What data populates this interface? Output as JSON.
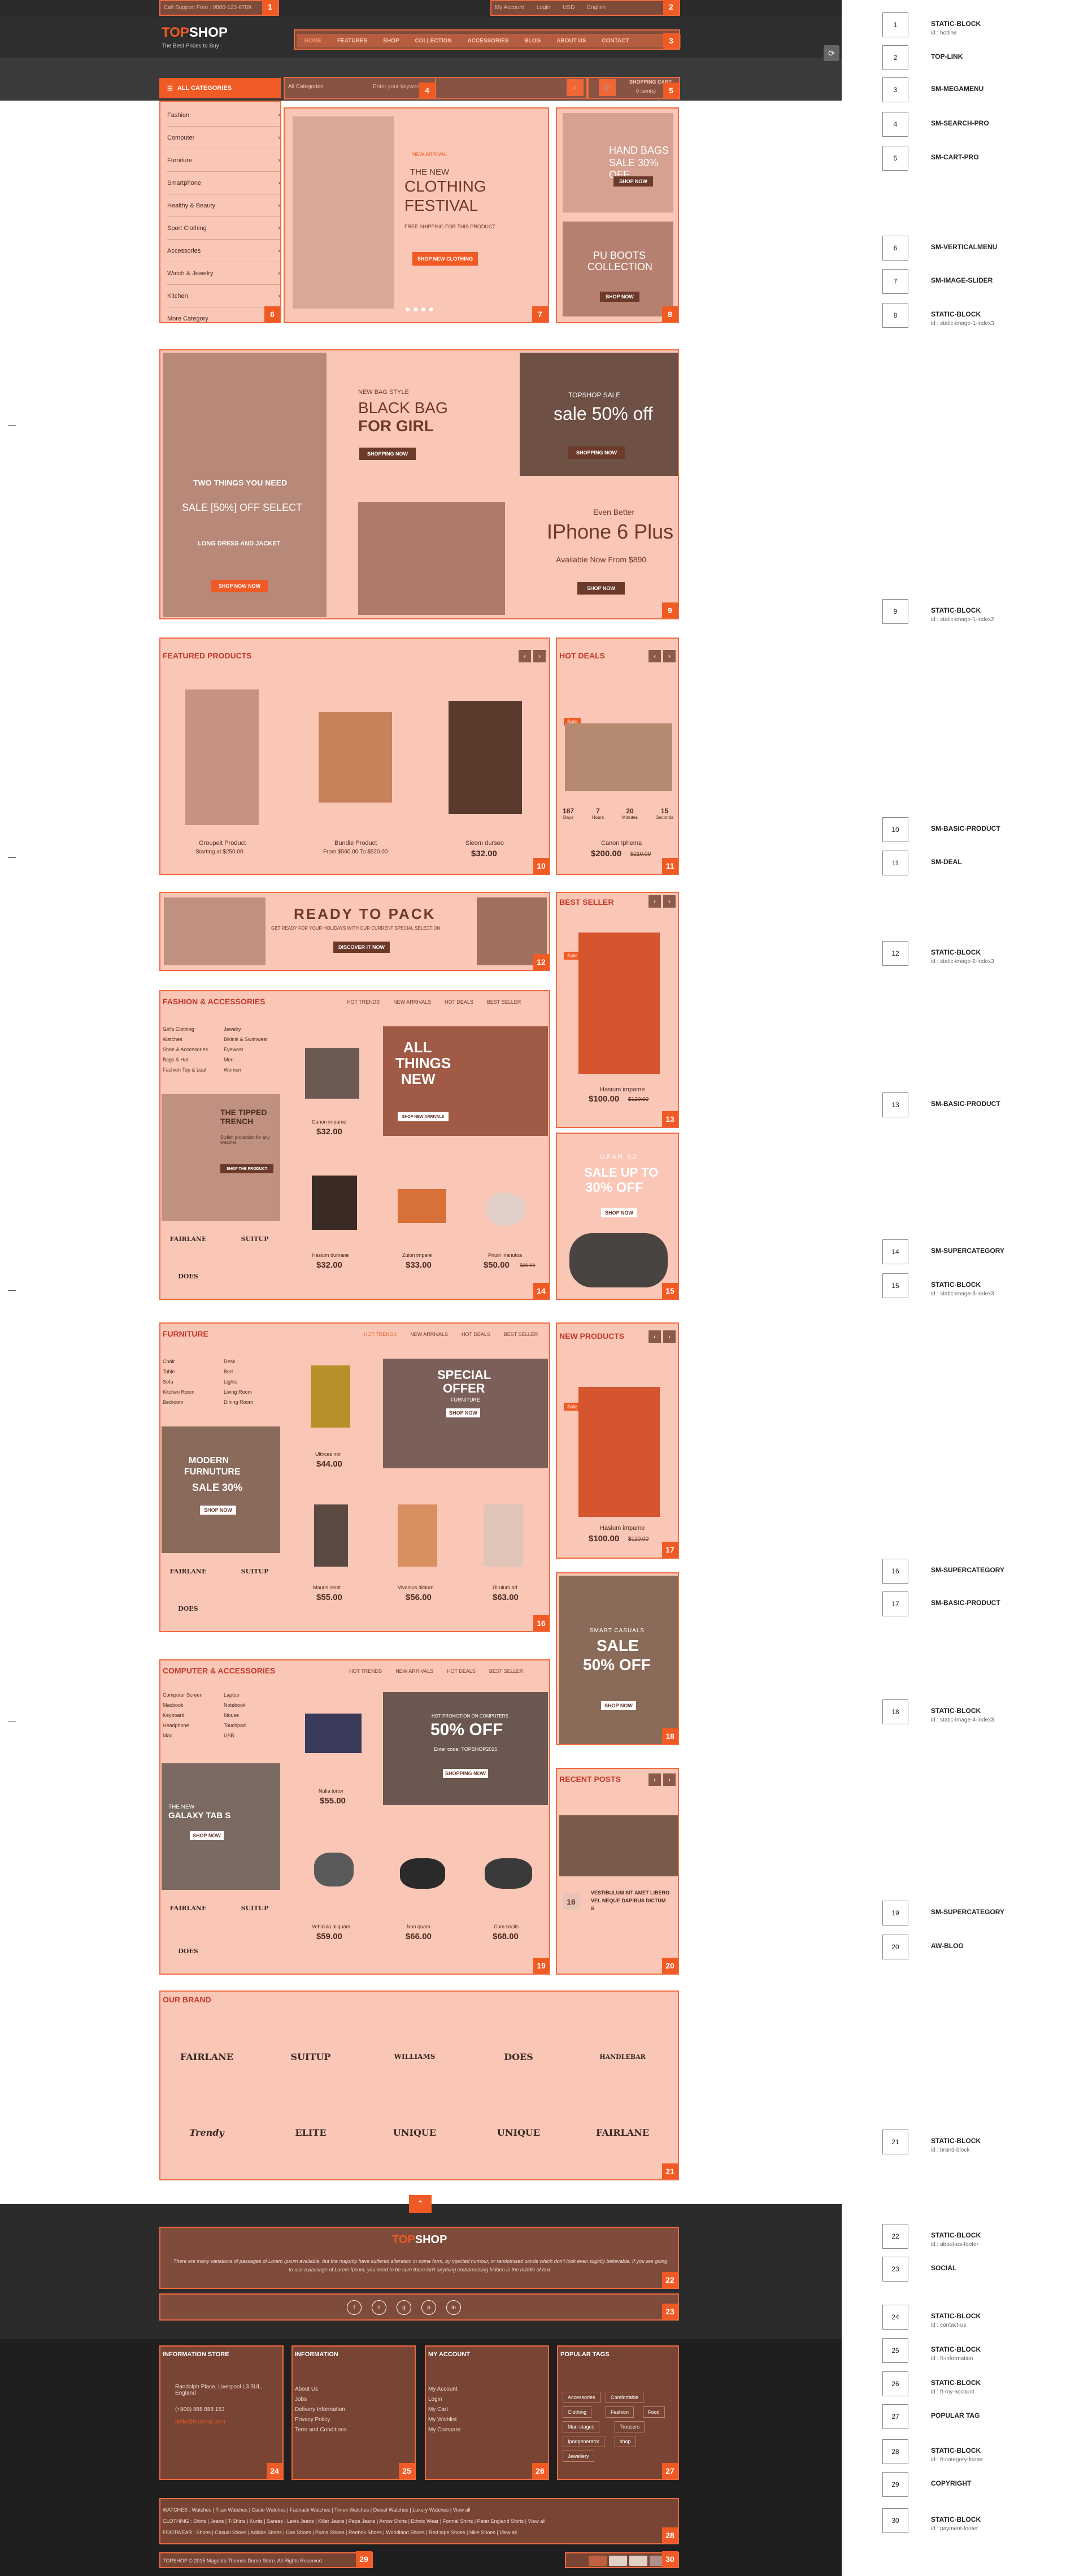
{
  "header": {
    "hotline": "Call Support Free : 0800-123-6789",
    "logo_top": "TOP",
    "logo_shop": "SHOP",
    "tagline": "The Best Prices to Buy",
    "account": "My Account",
    "wishlist": "Login",
    "currency": "USD",
    "language": "English",
    "nav": [
      "HOME",
      "FEATURES",
      "SHOP",
      "COLLECTION",
      "ACCESSORIES",
      "BLOG",
      "ABOUT US",
      "CONTACT"
    ],
    "categories_label": "ALL CATEGORIES",
    "search_select": "All Categories",
    "search_placeholder": "Enter your keyword",
    "cart_label": "SHOPPING CART",
    "cart_count": "0 item(s)"
  },
  "sidebar_menu": [
    "Fashion",
    "Computer",
    "Furniture",
    "Smartphone",
    "Healthy & Beauty",
    "Sport Clothing",
    "Accessories",
    "Watch & Jewelry",
    "Kitchen",
    "More Category"
  ],
  "slider": {
    "kicker": "NEW ARRIVAL",
    "title_1": "THE NEW",
    "title_2": "CLOTHING",
    "title_3": "FESTIVAL",
    "sub": "FREE SHIPPING FOR THIS PRODUCT",
    "button": "SHOP NEW CLOTHING"
  },
  "side_banners": [
    {
      "title": "HAND BAGS",
      "sub": "SALE 30% OFF",
      "button": "SHOP NOW"
    },
    {
      "title": "PU BOOTS",
      "sub": "COLLECTION",
      "button": "SHOP NOW"
    }
  ],
  "banners_2": {
    "left_title": "TWO THINGS YOU NEED",
    "left_sale": "SALE [50%] OFF SELECT",
    "left_sub": "LONG DRESS AND JACKET",
    "left_btn": "SHOP NOW NOW",
    "bag_kicker": "NEW BAG STYLE",
    "bag_title_1": "BLACK BAG",
    "bag_title_2": "FOR GIRL",
    "bag_btn": "SHOPPING NOW",
    "top_kicker": "TOPSHOP SALE",
    "top_sale": "sale 50% off",
    "top_btn": "SHOPPING NOW",
    "phone_kicker": "Even Better",
    "phone_title": "IPhone 6 Plus",
    "phone_sub": "Available Now From $890",
    "phone_btn": "SHOP NOW"
  },
  "featured": {
    "title": "FEATURED PRODUCTS",
    "items": [
      {
        "name": "Groupeit Product",
        "price": "Starting at $250.00"
      },
      {
        "name": "Bundle Product",
        "price": "From $560.00 To $520.00"
      },
      {
        "name": "Sieom durseo",
        "price": "$32.00"
      }
    ]
  },
  "hot_deals": {
    "title": "HOT DEALS",
    "countdown": [
      {
        "v": "187",
        "l": "Days"
      },
      {
        "v": "7",
        "l": "Hours"
      },
      {
        "v": "20",
        "l": "Minutes"
      },
      {
        "v": "15",
        "l": "Seconds"
      }
    ],
    "name": "Canon Iphema",
    "price": "$200.00",
    "old": "$210.00",
    "badge": "Sale"
  },
  "ready": {
    "title": "READY TO PACK",
    "sub": "GET READY FOR YOUR HOLIDAYS WITH OUR CURRENT SPECIAL SELECTION",
    "button": "DISCOVER IT NOW"
  },
  "best_seller": {
    "title": "BEST SELLER",
    "name": "Hasium impame",
    "price": "$100.00",
    "old": "$120.00",
    "badge": "Sale"
  },
  "fashion": {
    "title": "FASHION & ACCESSORIES",
    "tabs": [
      "HOT TRENDS",
      "NEW ARRIVALS",
      "HOT DEALS",
      "BEST SELLER"
    ],
    "links_a": [
      "Girl's Clothing",
      "Watches",
      "Shoe & Accessories",
      "Bags & Hat",
      "Fashion Top & Leaf"
    ],
    "links_b": [
      "Jewelry",
      "Bikinis & Swimwear",
      "Eyewear",
      "Men",
      "Women"
    ],
    "promo_title": "THE TIPPED TRENCH",
    "promo_sub": "Stylish protection for any weather",
    "promo_btn": "SHOP THE PRODUCT",
    "hero_title_1": "ALL",
    "hero_title_2": "THINGS",
    "hero_title_3": "NEW",
    "hero_btn": "SHOP NEW ARRIVALS",
    "items": [
      {
        "name": "Canon impame",
        "price": "$32.00"
      },
      {
        "name": "Hasium dumane",
        "price": "$32.00"
      },
      {
        "name": "Zuion impare",
        "price": "$33.00"
      },
      {
        "name": "Priuin inanutoa",
        "price": "$50.00",
        "old": "$00.00"
      }
    ],
    "brands": [
      "FAIRLANE",
      "SUITUP",
      "DOES"
    ]
  },
  "sale_banner": {
    "kicker": "GEAR S2",
    "title": "SALE UP TO",
    "pct": "30% OFF",
    "button": "SHOP NOW"
  },
  "furniture": {
    "title": "FURNITURE",
    "tabs": [
      "HOT TRENDS",
      "NEW ARRIVALS",
      "HOT DEALS",
      "BEST SELLER"
    ],
    "links_a": [
      "Chair",
      "Table",
      "Sofa",
      "Kitchen Room",
      "Bedroom"
    ],
    "links_b": [
      "Desk",
      "Bed",
      "Lights",
      "Living Room",
      "Dining Room"
    ],
    "promo_title_1": "MODERN",
    "promo_title_2": "FURNUTURE",
    "promo_sale": "SALE 30%",
    "promo_btn": "SHOP NOW",
    "hero_title_1": "SPECIAL",
    "hero_title_2": "OFFER",
    "hero_sub": "FURNITURE",
    "hero_btn": "SHOP NOW",
    "items": [
      {
        "name": "Ultrices mir",
        "price": "$44.00"
      },
      {
        "name": "Mauris sentt",
        "price": "$55.00"
      },
      {
        "name": "Vivamus dictum",
        "price": "$56.00"
      },
      {
        "name": "Ut ulum ad",
        "price": "$63.00"
      }
    ],
    "brands": [
      "FAIRLANE",
      "SUITUP",
      "DOES"
    ]
  },
  "new_products": {
    "title": "NEW PRODUCTS",
    "name": "Hasium impame",
    "price": "$100.00",
    "old": "$120.00",
    "badge": "Sale"
  },
  "smart_casual": {
    "kicker": "SMART CASUALS",
    "title": "SALE",
    "pct": "50% OFF",
    "button": "SHOP NOW"
  },
  "computer": {
    "title": "COMPUTER & ACCESSORIES",
    "tabs": [
      "HOT TRENDS",
      "NEW ARRIVALS",
      "HOT DEALS",
      "BEST SELLER"
    ],
    "links_a": [
      "Computer Screen",
      "Macbook",
      "Keyboard",
      "Headphone",
      "Mac"
    ],
    "links_b": [
      "Laptop",
      "Notebook",
      "Mouse",
      "Touchpad",
      "USB"
    ],
    "promo_title_1": "THE NEW",
    "promo_title_2": "GALAXY TAB S",
    "promo_btn": "SHOP NOW",
    "hero_kicker": "HOT PROMOTION ON COMPUTERS",
    "hero_pct": "50% OFF",
    "hero_sub": "Enter code: TOPSHOP2015",
    "hero_btn": "SHOPPING NOW",
    "items": [
      {
        "name": "Nulla tortor",
        "price": "$55.00"
      },
      {
        "name": "Vehicula aliquam",
        "price": "$59.00"
      },
      {
        "name": "Non quam",
        "price": "$66.00"
      },
      {
        "name": "Cum sociis",
        "price": "$68.00"
      }
    ],
    "brands": [
      "FAIRLANE",
      "SUITUP",
      "DOES"
    ]
  },
  "recent_posts": {
    "title": "RECENT POSTS",
    "date": "16",
    "post": "VESTIBULUM SIT AMET LIBERO VEL NEQUE DAPIBUS DICTUM S"
  },
  "our_brand": {
    "title": "OUR BRAND",
    "row1": [
      "FAIRLANE",
      "SUITUP",
      "WILLIAMS",
      "DOES",
      "HANDLEBAR"
    ],
    "row2": [
      "Trendy",
      "ELITE",
      "UNIQUE",
      "UNIQUE",
      "FAIRLANE"
    ]
  },
  "footer": {
    "logo_top": "TOP",
    "logo_shop": "SHOP",
    "about": "There are many variations of passages of Lorem Ipsum available, but the majority have suffered alteration in some form, by injected humour, or randomised words which don't look even slightly believable. If you are going to use a passage of Lorem Ipsum, you need to be sure there isn't anything embarrassing hidden in the middle of text.",
    "social": [
      "f",
      "t",
      "g",
      "p",
      "in"
    ],
    "col1_title": "INFORMATION STORE",
    "col1": [
      "Randolph Place, Liverpool L3 5UL, England",
      "(+800) 888 888 153",
      "hello@topshop.com"
    ],
    "col2_title": "INFORMATION",
    "col2": [
      "About Us",
      "Jobs",
      "Delivery Information",
      "Privacy Policy",
      "Term and Conditions"
    ],
    "col3_title": "MY ACCOUNT",
    "col3": [
      "My Account",
      "Login",
      "My Cart",
      "My Wishlist",
      "My Compare"
    ],
    "col4_title": "POPULAR TAGS",
    "tags": [
      "Accessories",
      "Comfortable",
      "Clothing",
      "Fashion",
      "Food",
      "Man-stages",
      "Trousers",
      "Ipodgenerator",
      "shop",
      "Jewellery"
    ],
    "watches": "WATCHES : Watches | Titan Watches | Casio Watches | Fastrack Watches | Timex Watches | Diesel Watches | Luxury Watches | View all",
    "clothing": "CLOTHING : Shirts | Jeans | T-Shirts | Kurtis | Sarees | Levis Jeans | Killer Jeans | Pepe Jeans | Arrow Shirts | Ethnic Wear | Formal Shirts | Peter England Shirts | View all",
    "footwear": "FOOTWEAR : Shoes | Casual Shoes | Adidas Shoes | Gas Shoes | Puma Shoes | Reebok Shoes | Woodland Shoes | Red tape Shoes | Nike Shoes | View all",
    "copyright": "TOPSHOP © 2015 Magento Themes Demo Store. All Rights Reserved.",
    "payments": [
      "mastercard",
      "paypal",
      "visa",
      "amex"
    ]
  },
  "labels": [
    {
      "n": "1",
      "t": "STATIC-BLOCK",
      "s": "id : hotline"
    },
    {
      "n": "2",
      "t": "TOP-LINK",
      "s": ""
    },
    {
      "n": "3",
      "t": "SM-MEGAMENU",
      "s": ""
    },
    {
      "n": "4",
      "t": "SM-SEARCH-PRO",
      "s": ""
    },
    {
      "n": "5",
      "t": "SM-CART-PRO",
      "s": ""
    },
    {
      "n": "6",
      "t": "SM-VERTICALMENU",
      "s": ""
    },
    {
      "n": "7",
      "t": "SM-IMAGE-SLIDER",
      "s": ""
    },
    {
      "n": "8",
      "t": "STATIC-BLOCK",
      "s": "id : static-image-1-index3"
    },
    {
      "n": "9",
      "t": "STATIC-BLOCK",
      "s": "id : static-image-1-index2"
    },
    {
      "n": "10",
      "t": "SM-BASIC-PRODUCT",
      "s": ""
    },
    {
      "n": "11",
      "t": "SM-DEAL",
      "s": ""
    },
    {
      "n": "12",
      "t": "STATIC-BLOCK",
      "s": "id : static-image-2-index3"
    },
    {
      "n": "13",
      "t": "SM-BASIC-PRODUCT",
      "s": ""
    },
    {
      "n": "14",
      "t": "SM-SUPERCATEGORY",
      "s": ""
    },
    {
      "n": "15",
      "t": "STATIC-BLOCK",
      "s": "id : static-image-3-index3"
    },
    {
      "n": "16",
      "t": "SM-SUPERCATEGORY",
      "s": ""
    },
    {
      "n": "17",
      "t": "SM-BASIC-PRODUCT",
      "s": ""
    },
    {
      "n": "18",
      "t": "STATIC-BLOCK",
      "s": "id : static-image-4-index3"
    },
    {
      "n": "19",
      "t": "SM-SUPERCATEGORY",
      "s": ""
    },
    {
      "n": "20",
      "t": "AW-BLOG",
      "s": ""
    },
    {
      "n": "21",
      "t": "STATIC-BLOCK",
      "s": "id : brand-block"
    },
    {
      "n": "22",
      "t": "STATIC-BLOCK",
      "s": "id : about-us-footer"
    },
    {
      "n": "23",
      "t": "SOCIAL",
      "s": ""
    },
    {
      "n": "24",
      "t": "STATIC-BLOCK",
      "s": "id : contact-us"
    },
    {
      "n": "25",
      "t": "STATIC-BLOCK",
      "s": "id : ft-information"
    },
    {
      "n": "26",
      "t": "STATIC-BLOCK",
      "s": "id : ft-my-account"
    },
    {
      "n": "27",
      "t": "POPULAR TAG",
      "s": ""
    },
    {
      "n": "28",
      "t": "STATIC-BLOCK",
      "s": "id : ft-category-footer"
    },
    {
      "n": "29",
      "t": "COPYRIGHT",
      "s": ""
    },
    {
      "n": "30",
      "t": "STATIC-BLOCK",
      "s": "id : payment-footer"
    }
  ]
}
